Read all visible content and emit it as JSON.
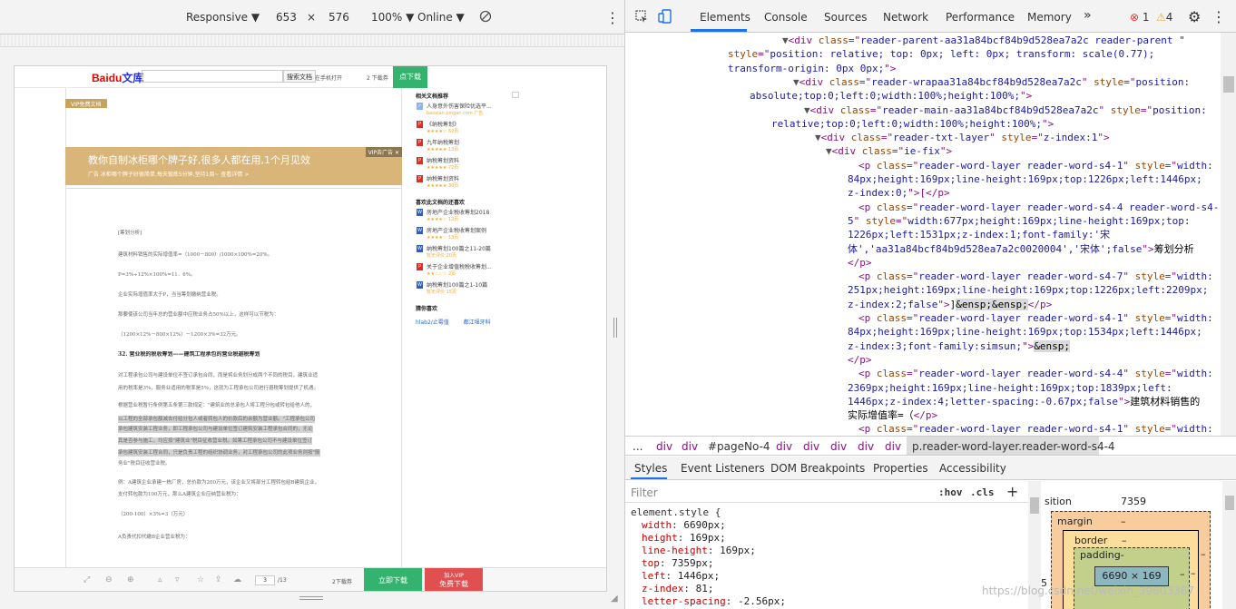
{
  "device_toolbar": {
    "device": "Responsive",
    "width": "653",
    "times": "×",
    "height": "576",
    "zoom": "100%",
    "network": "Online",
    "caret": "▼",
    "menu": "⋮"
  },
  "page": {
    "logo_a": "Bai",
    "logo_b": "du",
    "logo_c": "文库",
    "search_button": "搜索文档",
    "phone_link": "在手机打开",
    "coins": "2 下载券",
    "download": "点下载",
    "vip_tag": "VIP免费文档",
    "ad_title": "教你自制冰柜哪个牌子好,很多人都在用,1个月见效",
    "ad_sub": "广告  冰柜哪个牌子好很简单,每天锻炼5分钟,坚持1周~   查看详情 >",
    "ad_tag": "VIP去广告 ✕",
    "doc_lines": [
      {
        "text": "[筹划分析]",
        "style": ""
      },
      {
        "text": "建筑材料销售的实际增值率=（1000－800）/1000×100%=20%。",
        "style": ""
      },
      {
        "text": "P=3%÷12%×100%=11．6%。",
        "style": ""
      },
      {
        "text": "企业实际增值率大于P，当当筹划缴纳营业税。",
        "style": ""
      },
      {
        "text": "那要使该公司当年总的营业额中应税业务占50%以上，这样可以节税为：",
        "style": ""
      },
      {
        "text": "（1200×12%－800×12%）－1200×3%=32万元。",
        "style": ""
      },
      {
        "text": "32. 营业税的税收筹划——建筑工程承包的营业税避税筹划",
        "style": "head"
      },
      {
        "text": "对工程承包公司与建设单位不签订承包合同，而是将业务划分成两个不同的税目，建筑业适",
        "style": ""
      },
      {
        "text": "用的税率是3%，服务业适用的税率是5%，这就为工程承包公司进行避税筹划提供了机遇。",
        "style": ""
      },
      {
        "text": "根据营业税暂行条例第五条第三款规定：\"建筑业的总承包人将工程分包或转包给他人的，",
        "style": ""
      },
      {
        "text": "以工程的全部承包额减去付给分包人或者转包人的价款后的余额为营业额。\"工程承包公司",
        "style": "hl"
      },
      {
        "text": "承包建筑安装工程业务，即工程承包公司与建设单位签订建筑安装工程承包合同的，无论",
        "style": "hl"
      },
      {
        "text": "其是否参与施工，均应按\"建筑业\"税目征收营业税。如果工程承包公司不与建设单位签订",
        "style": "hl"
      },
      {
        "text": "承包建筑安装工程合同，只是负责工程的组织协调业务，对工程承包公司的此项业务则按\"服",
        "style": "hl"
      },
      {
        "text": "务业\"税目征收营业税。",
        "style": ""
      },
      {
        "text": "例：A建筑企业承建一栋厂房，总价款为200万元，该企业又将部分工程转包给B建筑企业，",
        "style": ""
      },
      {
        "text": "支付转包款为100万元，那么A建筑企业应纳营业税为：",
        "style": ""
      },
      {
        "text": "（200-100）×3%=3（万元）",
        "style": ""
      },
      {
        "text": "A负责代扣代缴B企业营业税为：",
        "style": ""
      }
    ],
    "related_title": "相关文档推荐",
    "related": [
      {
        "title": "人身意外伤害保险优选平...",
        "meta": "baoxian.pingan.com   广告",
        "icon": "ad"
      },
      {
        "title": "《纳税筹划》",
        "meta": "★★★★☆ 62页",
        "icon": "pdf"
      },
      {
        "title": "九年纳税筹划",
        "meta": "★★★★★ 13页",
        "icon": "pdf"
      },
      {
        "title": "纳税筹划资料",
        "meta": "★★★★★ 72页",
        "icon": "pdf"
      },
      {
        "title": "纳税筹划资料",
        "meta": "★★★★★ 30页",
        "icon": "pdf"
      }
    ],
    "liked_title": "喜欢此文档的还喜欢",
    "liked": [
      {
        "title": "房地产企业税收筹划2018",
        "meta": "★★★★☆ 12页",
        "icon": "doc"
      },
      {
        "title": "房地产企业税收筹划案例",
        "meta": "★★★★☆ 13页",
        "icon": "doc"
      },
      {
        "title": "纳税筹划100篇之11-20篇",
        "meta": "暂无评价 20页",
        "icon": "doc"
      },
      {
        "title": "关于企业增值税税收筹划...",
        "meta": "★★☆☆☆ 2页",
        "icon": "pdf"
      },
      {
        "title": "纳税筹划100篇之1-10篇",
        "meta": "暂无评价 15页",
        "icon": "doc"
      }
    ],
    "guess_title": "猜你喜欢",
    "guess": [
      "hlab2/止霉值",
      "都江堰牙科"
    ],
    "page_input": "3",
    "page_total": "/13",
    "bottom_coins": "2下载券",
    "bottom_download": "立即下载",
    "vip_line1": "加入VIP",
    "vip_line2": "免费下载"
  },
  "devtools": {
    "tabs": [
      "Elements",
      "Console",
      "Sources",
      "Network",
      "Performance",
      "Memory"
    ],
    "more": "»",
    "errors": "1",
    "warnings": "4",
    "dom_lines": [
      {
        "indent": 0,
        "open": "▼",
        "html": [
          [
            "tg",
            "<div "
          ],
          [
            "an",
            "class"
          ],
          [
            "tg",
            "=\""
          ],
          [
            "av",
            "reader-parent-aa31a84bcf84b9d528ea7a2c reader-parent \""
          ]
        ]
      },
      {
        "indent": 0,
        "cont": true,
        "html": [
          [
            "an",
            "style"
          ],
          [
            "tg",
            "=\""
          ],
          [
            "av",
            "position: relative; top: 0px; left: 0px; transform: scale(0.77);"
          ]
        ]
      },
      {
        "indent": 0,
        "cont": true,
        "html": [
          [
            "av",
            "transform-origin: 0px 0px;"
          ],
          [
            "tg",
            "\">"
          ]
        ]
      },
      {
        "indent": 1,
        "open": "▼",
        "html": [
          [
            "tg",
            "<div "
          ],
          [
            "an",
            "class"
          ],
          [
            "tg",
            "=\""
          ],
          [
            "av",
            "reader-wrapaa31a84bcf84b9d528ea7a2c"
          ],
          [
            "tg",
            "\" "
          ],
          [
            "an",
            "style"
          ],
          [
            "tg",
            "=\""
          ],
          [
            "av",
            "position:"
          ]
        ]
      },
      {
        "indent": 1,
        "cont": true,
        "html": [
          [
            "av",
            "absolute;top:0;left:0;width:100%;height:100%;"
          ],
          [
            "tg",
            "\">"
          ]
        ]
      },
      {
        "indent": 2,
        "open": "▼",
        "html": [
          [
            "tg",
            "<div "
          ],
          [
            "an",
            "class"
          ],
          [
            "tg",
            "=\""
          ],
          [
            "av",
            "reader-main-aa31a84bcf84b9d528ea7a2c"
          ],
          [
            "tg",
            "\" "
          ],
          [
            "an",
            "style"
          ],
          [
            "tg",
            "=\""
          ],
          [
            "av",
            "position:"
          ]
        ]
      },
      {
        "indent": 2,
        "cont": true,
        "html": [
          [
            "av",
            "relative;top:0;left:0;width:100%;height:100%;"
          ],
          [
            "tg",
            "\">"
          ]
        ]
      },
      {
        "indent": 3,
        "open": "▼",
        "html": [
          [
            "tg",
            "<div "
          ],
          [
            "an",
            "class"
          ],
          [
            "tg",
            "=\""
          ],
          [
            "av",
            "reader-txt-layer"
          ],
          [
            "tg",
            "\" "
          ],
          [
            "an",
            "style"
          ],
          [
            "tg",
            "=\""
          ],
          [
            "av",
            "z-index:1"
          ],
          [
            "tg",
            "\">"
          ]
        ]
      },
      {
        "indent": 4,
        "open": "▼",
        "html": [
          [
            "tg",
            "<div "
          ],
          [
            "an",
            "class"
          ],
          [
            "tg",
            "=\""
          ],
          [
            "av",
            "ie-fix"
          ],
          [
            "tg",
            "\">"
          ]
        ]
      },
      {
        "indent": 5,
        "html": [
          [
            "tg",
            "<p "
          ],
          [
            "an",
            "class"
          ],
          [
            "tg",
            "=\""
          ],
          [
            "av",
            "reader-word-layer reader-word-s4-1"
          ],
          [
            "tg",
            "\" "
          ],
          [
            "an",
            "style"
          ],
          [
            "tg",
            "=\""
          ],
          [
            "av",
            "width:"
          ]
        ]
      },
      {
        "indent": 5,
        "cont": true,
        "html": [
          [
            "av",
            "84px;height:169px;line-height:169px;top:1226px;left:1446px;"
          ]
        ]
      },
      {
        "indent": 5,
        "cont": true,
        "html": [
          [
            "av",
            "z-index:0;"
          ],
          [
            "tg",
            "\">[</p>"
          ]
        ]
      },
      {
        "indent": 5,
        "html": [
          [
            "tg",
            "<p "
          ],
          [
            "an",
            "class"
          ],
          [
            "tg",
            "=\""
          ],
          [
            "av",
            "reader-word-layer reader-word-s4-4 reader-word-s4-"
          ]
        ]
      },
      {
        "indent": 5,
        "cont": true,
        "html": [
          [
            "av",
            "5"
          ],
          [
            "tg",
            "\" "
          ],
          [
            "an",
            "style"
          ],
          [
            "tg",
            "=\""
          ],
          [
            "av",
            "width:677px;height:169px;line-height:169px;top:"
          ]
        ]
      },
      {
        "indent": 5,
        "cont": true,
        "html": [
          [
            "av",
            "1226px;left:1531px;z-index:1;font-family:'宋"
          ]
        ]
      },
      {
        "indent": 5,
        "cont": true,
        "html": [
          [
            "av",
            "体','aa31a84bcf84b9d528ea7a2c0020004','宋体';false"
          ],
          [
            "tg",
            "\">"
          ],
          [
            "tx",
            "筹划分析"
          ]
        ]
      },
      {
        "indent": 5,
        "cont": true,
        "html": [
          [
            "tg",
            "</p>"
          ]
        ]
      },
      {
        "indent": 5,
        "html": [
          [
            "tg",
            "<p "
          ],
          [
            "an",
            "class"
          ],
          [
            "tg",
            "=\""
          ],
          [
            "av",
            "reader-word-layer reader-word-s4-7"
          ],
          [
            "tg",
            "\" "
          ],
          [
            "an",
            "style"
          ],
          [
            "tg",
            "=\""
          ],
          [
            "av",
            "width:"
          ]
        ]
      },
      {
        "indent": 5,
        "cont": true,
        "html": [
          [
            "av",
            "251px;height:169px;line-height:169px;top:1226px;left:2209px;"
          ]
        ]
      },
      {
        "indent": 5,
        "cont": true,
        "html": [
          [
            "av",
            "z-index:2;false"
          ],
          [
            "tg",
            "\">"
          ],
          [
            "tx",
            "]"
          ],
          [
            "hl",
            "&ensp;&ensp;"
          ],
          [
            "tg",
            "</p>"
          ]
        ]
      },
      {
        "indent": 5,
        "html": [
          [
            "tg",
            "<p "
          ],
          [
            "an",
            "class"
          ],
          [
            "tg",
            "=\""
          ],
          [
            "av",
            "reader-word-layer reader-word-s4-1"
          ],
          [
            "tg",
            "\" "
          ],
          [
            "an",
            "style"
          ],
          [
            "tg",
            "=\""
          ],
          [
            "av",
            "width:"
          ]
        ]
      },
      {
        "indent": 5,
        "cont": true,
        "html": [
          [
            "av",
            "84px;height:169px;line-height:169px;top:1534px;left:1446px;"
          ]
        ]
      },
      {
        "indent": 5,
        "cont": true,
        "html": [
          [
            "av",
            "z-index:3;font-family:simsun;"
          ],
          [
            "tg",
            "\">"
          ],
          [
            "hl",
            "&ensp;"
          ]
        ]
      },
      {
        "indent": 5,
        "cont": true,
        "html": [
          [
            "tg",
            "</p>"
          ]
        ]
      },
      {
        "indent": 5,
        "html": [
          [
            "tg",
            "<p "
          ],
          [
            "an",
            "class"
          ],
          [
            "tg",
            "=\""
          ],
          [
            "av",
            "reader-word-layer reader-word-s4-4"
          ],
          [
            "tg",
            "\" "
          ],
          [
            "an",
            "style"
          ],
          [
            "tg",
            "=\""
          ],
          [
            "av",
            "width:"
          ]
        ]
      },
      {
        "indent": 5,
        "cont": true,
        "html": [
          [
            "av",
            "2369px;height:169px;line-height:169px;top:1839px;left:"
          ]
        ]
      },
      {
        "indent": 5,
        "cont": true,
        "html": [
          [
            "av",
            "1446px;z-index:4;letter-spacing:-0.67px;false"
          ],
          [
            "tg",
            "\">"
          ],
          [
            "tx",
            "建筑材料销售的"
          ]
        ]
      },
      {
        "indent": 5,
        "cont": true,
        "html": [
          [
            "tx",
            "实际增值率=（"
          ],
          [
            "tg",
            "</p>"
          ]
        ]
      },
      {
        "indent": 5,
        "html": [
          [
            "tg",
            "<p "
          ],
          [
            "an",
            "class"
          ],
          [
            "tg",
            "=\""
          ],
          [
            "av",
            "reader-word-layer reader-word-s4-1"
          ],
          [
            "tg",
            "\" "
          ],
          [
            "an",
            "style"
          ],
          [
            "tg",
            "=\""
          ],
          [
            "av",
            "width:"
          ]
        ]
      }
    ],
    "breadcrumbs": [
      "...",
      "div",
      "div",
      "#pageNo-4",
      "div",
      "div",
      "div",
      "div",
      "div",
      "p.reader-word-layer.reader-word-s4-4"
    ],
    "sub_tabs": [
      "Styles",
      "Event Listeners",
      "DOM Breakpoints",
      "Properties",
      "Accessibility"
    ],
    "filter_placeholder": "Filter",
    "hov": ":hov",
    "cls": ".cls",
    "plus": "+",
    "selector": "element.style {",
    "props": [
      {
        "name": "width",
        "value": "6690px;"
      },
      {
        "name": "height",
        "value": "169px;"
      },
      {
        "name": "line-height",
        "value": "169px;"
      },
      {
        "name": "top",
        "value": "7359px;"
      },
      {
        "name": "left",
        "value": "1446px;"
      },
      {
        "name": "z-index",
        "value": "81;"
      },
      {
        "name": "letter-spacing",
        "value": "-2.56px;"
      }
    ],
    "box": {
      "position_label": "sition",
      "position_value": "7359",
      "margin": "margin",
      "border": "border",
      "padding": "padding-",
      "dash": "–",
      "content": "6690 × 169",
      "left_num": "5"
    }
  },
  "watermark": "https://blog.csdn.net/weixin_39603367"
}
